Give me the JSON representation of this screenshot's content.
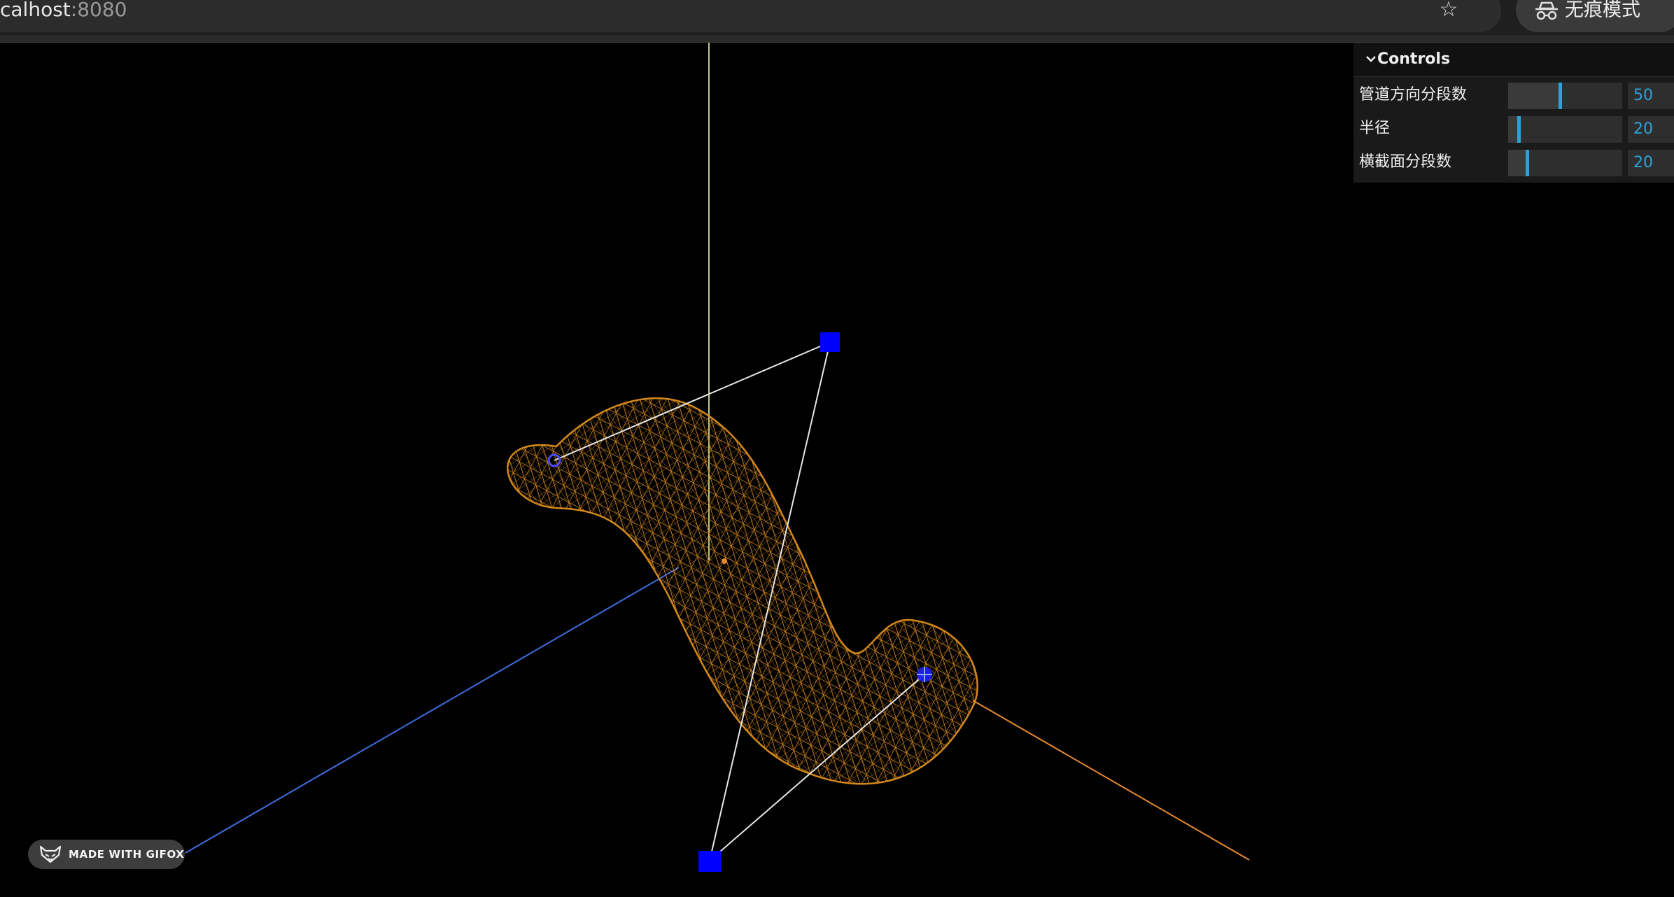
{
  "browser": {
    "url_host": "calhost",
    "url_port": ":8080",
    "incognito_label": "无痕模式"
  },
  "gui": {
    "title": "Controls",
    "controls": [
      {
        "label": "管道方向分段数",
        "value": "50",
        "fraction": 0.46
      },
      {
        "label": "半径",
        "value": "20",
        "fraction": 0.1
      },
      {
        "label": "横截面分段数",
        "value": "20",
        "fraction": 0.17
      }
    ]
  },
  "badge": {
    "text": "MADE WITH GIFOX"
  },
  "colors": {
    "background": "#000000",
    "tube": "#e0901c",
    "axis_x": "#e6892d",
    "axis_y": "#b7c98a",
    "axis_z": "#3f6de0",
    "control_point": "#0000ff",
    "control_line": "#e6e6e6",
    "gui_accent": "#2fa1d6"
  }
}
